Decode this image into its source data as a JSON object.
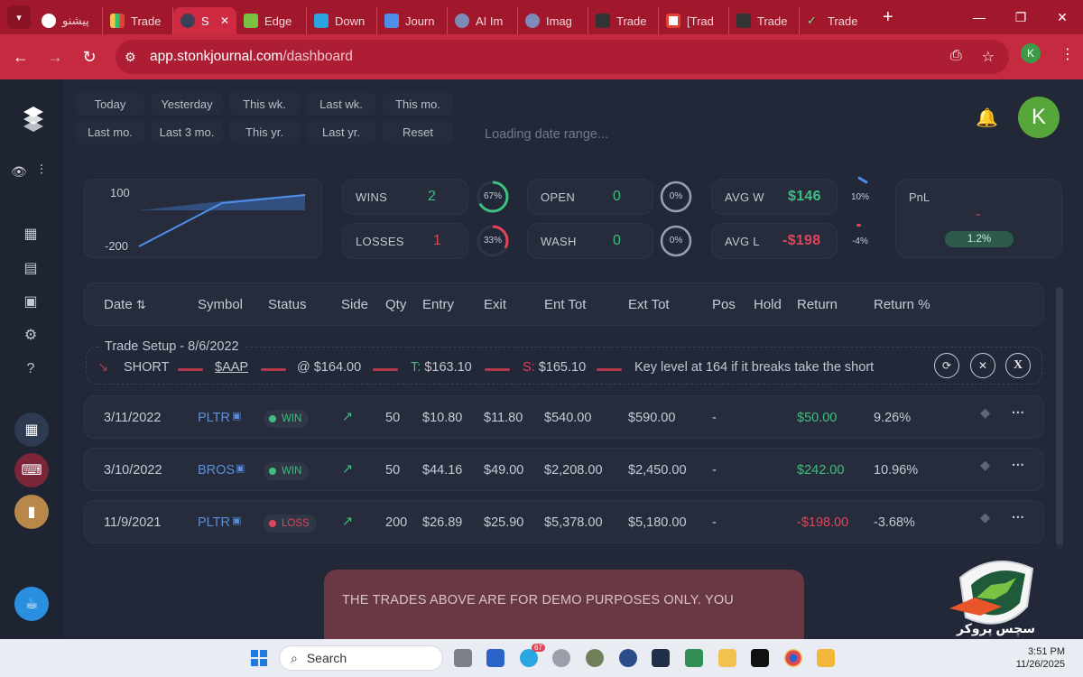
{
  "browser": {
    "tabs": [
      {
        "label": "پیشنو",
        "icon": "openai-icon",
        "color": "#ffffff"
      },
      {
        "label": "Trade",
        "icon": "chart-bars-icon",
        "color": "#2fbf71"
      },
      {
        "label": "S",
        "icon": "stonk-icon",
        "color": "#3c3f55",
        "active": true
      },
      {
        "label": "Edge",
        "icon": "edge-e-icon",
        "color": "#7bc142"
      },
      {
        "label": "Down",
        "icon": "download-icon",
        "color": "#29a5e3"
      },
      {
        "label": "Journ",
        "icon": "notebook-icon",
        "color": "#4e8ee8"
      },
      {
        "label": "AI Im",
        "icon": "ai-icon",
        "color": "#7c8bb8"
      },
      {
        "label": "Imag",
        "icon": "image-icon",
        "color": "#7c8bb8"
      },
      {
        "label": "Trade",
        "icon": "trade-icon",
        "color": "#333333"
      },
      {
        "label": "[Trad",
        "icon": "gmail-icon",
        "color": "#e34133"
      },
      {
        "label": "Trade",
        "icon": "trade-icon",
        "color": "#333333"
      },
      {
        "label": "Trade",
        "icon": "check-icon",
        "color": "#2fbf71"
      }
    ],
    "url_domain": "app.stonkjournal.com",
    "url_path": "/dashboard",
    "profile_initial": "K"
  },
  "dates": {
    "row1": [
      "Today",
      "Yesterday",
      "This wk.",
      "Last wk.",
      "This mo."
    ],
    "row2": [
      "Last mo.",
      "Last 3 mo.",
      "This yr.",
      "Last yr.",
      "Reset"
    ],
    "loading": "Loading date range..."
  },
  "user": {
    "initial": "K"
  },
  "mini_chart": {
    "y_top": "100",
    "y_bottom": "-200"
  },
  "stats": {
    "wins_label": "WINS",
    "wins_value": "2",
    "wins_pct": "67%",
    "losses_label": "LOSSES",
    "losses_value": "1",
    "losses_pct": "33%",
    "open_label": "OPEN",
    "open_value": "0",
    "open_pct": "0%",
    "wash_label": "WASH",
    "wash_value": "0",
    "wash_pct": "0%",
    "avgw_label": "AVG W",
    "avgw_value": "$146",
    "avgw_pct": "10%",
    "avgl_label": "AVG L",
    "avgl_value": "-$198",
    "avgl_pct": "-4%",
    "pnl_label": "PnL",
    "pnl_value": "-",
    "pnl_pct": "1.2%",
    "win_ratio": 0.67,
    "loss_ratio": 0.33
  },
  "table": {
    "headers": [
      "Date",
      "Symbol",
      "Status",
      "Side",
      "Qty",
      "Entry",
      "Exit",
      "Ent Tot",
      "Ext Tot",
      "Pos",
      "Hold",
      "Return",
      "Return %"
    ],
    "setup": {
      "title": "Trade Setup - 8/6/2022",
      "direction": "SHORT",
      "symbol": "$AAP",
      "at": "@ $164.00",
      "target_label": "T:",
      "target": "$163.10",
      "stop_label": "S:",
      "stop": "$165.10",
      "note": "Key level at 164 if it breaks take the short"
    },
    "rows": [
      {
        "date": "3/11/2022",
        "symbol": "PLTR",
        "status": "WIN",
        "qty": "50",
        "entry": "$10.80",
        "exit": "$11.80",
        "ent_tot": "$540.00",
        "ext_tot": "$590.00",
        "pos": "-",
        "return": "$50.00",
        "return_pct": "9.26%"
      },
      {
        "date": "3/10/2022",
        "symbol": "BROS",
        "status": "WIN",
        "qty": "50",
        "entry": "$44.16",
        "exit": "$49.00",
        "ent_tot": "$2,208.00",
        "ext_tot": "$2,450.00",
        "pos": "-",
        "return": "$242.00",
        "return_pct": "10.96%"
      },
      {
        "date": "11/9/2021",
        "symbol": "PLTR",
        "status": "LOSS",
        "qty": "200",
        "entry": "$26.89",
        "exit": "$25.90",
        "ent_tot": "$5,378.00",
        "ext_tot": "$5,180.00",
        "pos": "-",
        "return": "-$198.00",
        "return_pct": "-3.68%"
      }
    ]
  },
  "disclaimer": "THE TRADES ABOVE ARE FOR DEMO PURPOSES ONLY. YOU",
  "watermark": {
    "text": "سچس پروکر"
  },
  "taskbar": {
    "search": "Search",
    "time": "3:51 PM",
    "date": "11/26/2025",
    "badge": "67"
  },
  "colors": {
    "brand_red": "#c52a40",
    "win": "#3fbf7f",
    "loss": "#e0455a",
    "accent": "#5b8ed6"
  }
}
